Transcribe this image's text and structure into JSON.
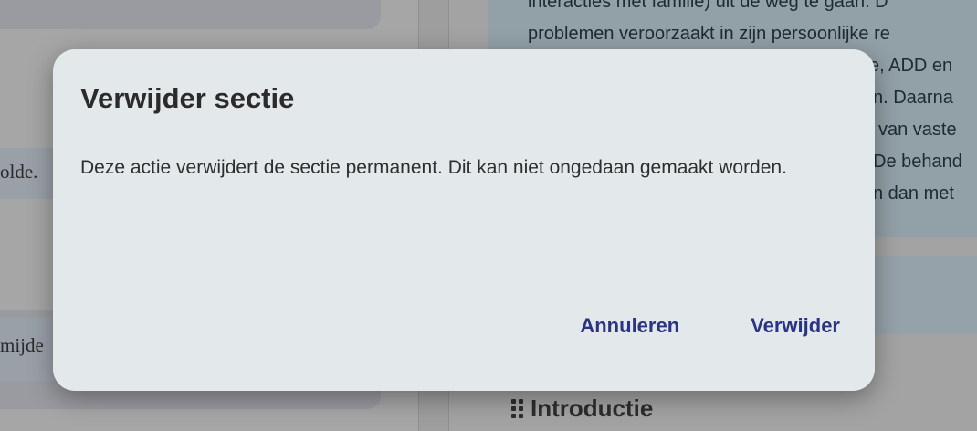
{
  "background": {
    "left_snippets": [
      "olde.",
      "mijde"
    ],
    "right_lines": [
      "interacties met familie) uit de weg te gaan. D",
      "problemen veroorzaakt in zijn persoonlijke re",
      "e, ADD en",
      "n. Daarna",
      "van vaste",
      "De behand",
      "n dan met"
    ],
    "section_heading": "Introductie",
    "section_heading_icon": "drag-handle-icon"
  },
  "dialog": {
    "title": "Verwijder sectie",
    "message": "Deze actie verwijdert de sectie permanent. Dit kan niet ongedaan gemaakt worden.",
    "cancel_label": "Annuleren",
    "confirm_label": "Verwijder",
    "accent_color": "#2b3289",
    "surface_color": "#e3e9eb"
  }
}
